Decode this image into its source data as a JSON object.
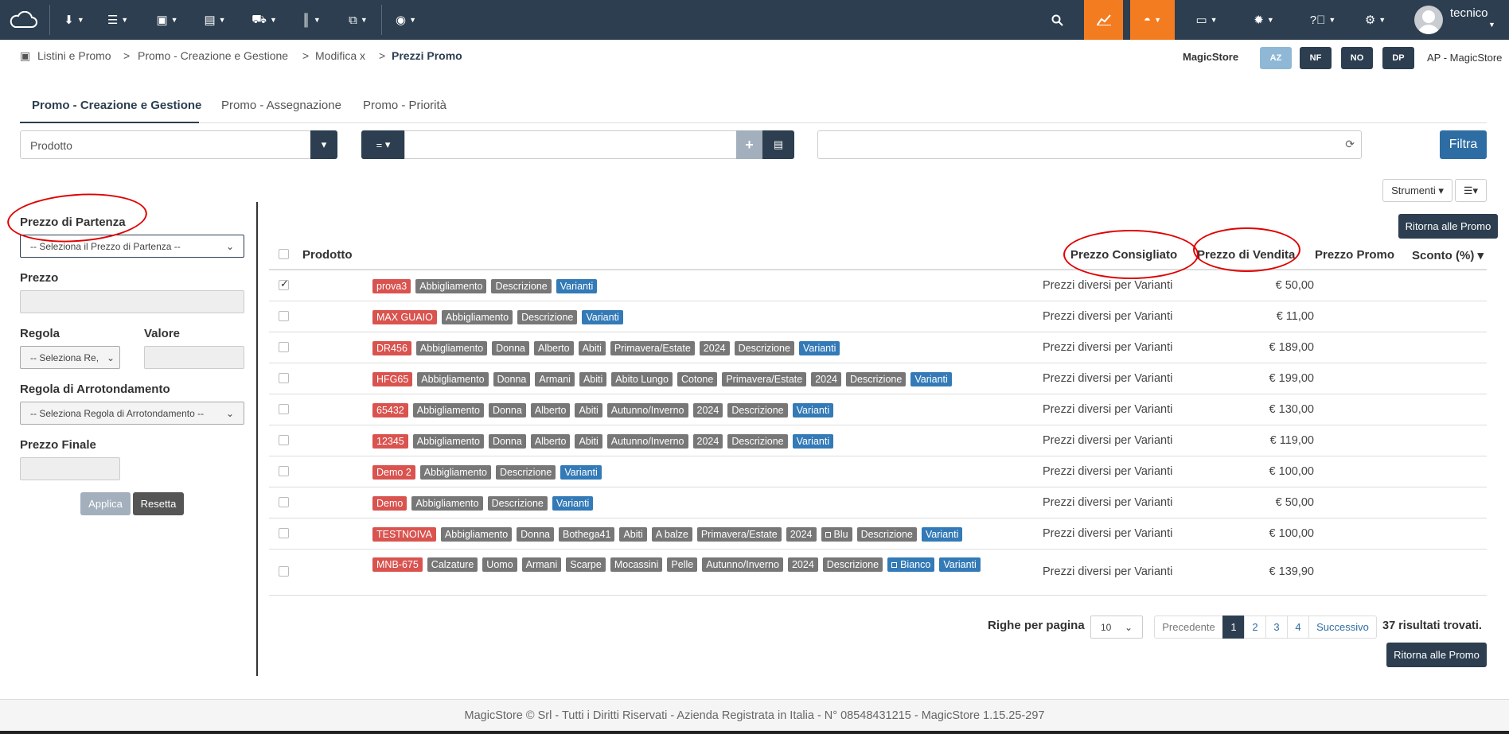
{
  "topbar": {
    "user": "tecnico",
    "icons": [
      "cloud-icon",
      "download-icon",
      "list-icon",
      "money-icon",
      "document-icon",
      "truck-icon",
      "barcode-icon",
      "copy-icon",
      "compass-icon",
      "search-icon",
      "chart-icon",
      "dashboard-icon",
      "id-card-icon",
      "alarm-icon",
      "help-icon",
      "cogs-icon"
    ],
    "orange": "#f47c20",
    "navy": "#2c3e50"
  },
  "breadcrumb": {
    "items": [
      "Listini e Promo",
      "Promo - Creazione e Gestione",
      "Modifica x"
    ],
    "current": "Prezzi Promo",
    "sep": ">"
  },
  "store": {
    "name": "MagicStore",
    "pills": [
      "AZ",
      "NF",
      "NO",
      "DP"
    ],
    "company": "AP - MagicStore"
  },
  "tabs": [
    "Promo - Creazione e Gestione",
    "Promo - Assegnazione",
    "Promo - Priorità"
  ],
  "filter": {
    "field": "Prodotto",
    "operator": "=",
    "value": "",
    "button": "Filtra"
  },
  "tools": {
    "strumenti": "Strumenti"
  },
  "left_panel": {
    "start_price_label": "Prezzo di Partenza",
    "start_price_select": "-- Seleziona il Prezzo di Partenza --",
    "price_label": "Prezzo",
    "rule_label": "Regola",
    "rule_select": "-- Seleziona Re,",
    "value_label": "Valore",
    "rounding_label": "Regola di Arrotondamento",
    "rounding_select": "-- Seleziona Regola di Arrotondamento --",
    "final_label": "Prezzo Finale",
    "apply": "Applica",
    "reset": "Resetta"
  },
  "table": {
    "return_button": "Ritorna alle Promo",
    "headers": {
      "product": "Prodotto",
      "recommended": "Prezzo Consigliato",
      "sale": "Prezzo di Vendita",
      "promo": "Prezzo Promo",
      "discount": "Sconto (%)"
    },
    "rows": [
      {
        "code": "prova3",
        "tags": [
          "Abbigliamento",
          "Descrizione"
        ],
        "variant": "Varianti",
        "consigliato": "Prezzi diversi per Varianti",
        "vendita": "€ 50,00",
        "checked": true
      },
      {
        "code": "MAX GUAIO",
        "tags": [
          "Abbigliamento",
          "Descrizione"
        ],
        "variant": "Varianti",
        "consigliato": "Prezzi diversi per Varianti",
        "vendita": "€ 11,00",
        "checked": false
      },
      {
        "code": "DR456",
        "tags": [
          "Abbigliamento",
          "Donna",
          "Alberto",
          "Abiti",
          "Primavera/Estate",
          "2024",
          "Descrizione"
        ],
        "variant": "Varianti",
        "consigliato": "Prezzi diversi per Varianti",
        "vendita": "€ 189,00",
        "checked": false
      },
      {
        "code": "HFG65",
        "tags": [
          "Abbigliamento",
          "Donna",
          "Armani",
          "Abiti",
          "Abito Lungo",
          "Cotone",
          "Primavera/Estate",
          "2024",
          "Descrizione"
        ],
        "variant": "Varianti",
        "consigliato": "Prezzi diversi per Varianti",
        "vendita": "€ 199,00",
        "checked": false
      },
      {
        "code": "65432",
        "tags": [
          "Abbigliamento",
          "Donna",
          "Alberto",
          "Abiti",
          "Autunno/Inverno",
          "2024",
          "Descrizione"
        ],
        "variant": "Varianti",
        "consigliato": "Prezzi diversi per Varianti",
        "vendita": "€ 130,00",
        "checked": false
      },
      {
        "code": "12345",
        "tags": [
          "Abbigliamento",
          "Donna",
          "Alberto",
          "Abiti",
          "Autunno/Inverno",
          "2024",
          "Descrizione"
        ],
        "variant": "Varianti",
        "consigliato": "Prezzi diversi per Varianti",
        "vendita": "€ 119,00",
        "checked": false
      },
      {
        "code": "Demo 2",
        "tags": [
          "Abbigliamento",
          "Descrizione"
        ],
        "variant": "Varianti",
        "consigliato": "Prezzi diversi per Varianti",
        "vendita": "€ 100,00",
        "checked": false
      },
      {
        "code": "Demo",
        "tags": [
          "Abbigliamento",
          "Descrizione"
        ],
        "variant": "Varianti",
        "consigliato": "Prezzi diversi per Varianti",
        "vendita": "€ 50,00",
        "checked": false
      },
      {
        "code": "TESTNOIVA",
        "tags": [
          "Abbigliamento",
          "Donna",
          "Bothega41",
          "Abiti",
          "A balze",
          "Primavera/Estate",
          "2024",
          "■Blu",
          "Descrizione"
        ],
        "variant": "Varianti",
        "consigliato": "Prezzi diversi per Varianti",
        "vendita": "€ 100,00",
        "checked": false
      },
      {
        "code": "MNB-675",
        "tags": [
          "Calzature",
          "Uomo",
          "Armani",
          "Scarpe",
          "Mocassini",
          "Pelle",
          "Autunno/Inverno",
          "2024",
          "Descrizione"
        ],
        "color_tag": "Bianco",
        "variant": "Varianti",
        "consigliato": "Prezzi diversi per Varianti",
        "vendita": "€ 139,90",
        "checked": false
      }
    ]
  },
  "pagination": {
    "rows_label": "Righe per pagina",
    "rows_value": "10",
    "prev": "Precedente",
    "pages": [
      "1",
      "2",
      "3",
      "4"
    ],
    "next": "Successivo",
    "results": "37 risultati trovati."
  },
  "footer": "MagicStore © Srl - Tutti i Diritti Riservati - Azienda Registrata in Italia - N° 08548431215 - MagicStore 1.15.25-297"
}
